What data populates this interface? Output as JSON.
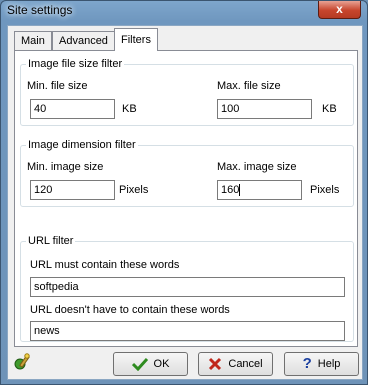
{
  "window": {
    "title": "Site settings",
    "close_glyph": "x"
  },
  "tabs": [
    {
      "label": "Main"
    },
    {
      "label": "Advanced"
    },
    {
      "label": "Filters",
      "active": true
    }
  ],
  "file_size_filter": {
    "legend": "Image file size filter",
    "min_label": "Min. file size",
    "min_value": "40",
    "min_unit": "KB",
    "max_label": "Max. file size",
    "max_value": "100",
    "max_unit": "KB"
  },
  "dimension_filter": {
    "legend": "Image dimension filter",
    "min_label": "Min. image size",
    "min_value": "120",
    "min_unit": "Pixels",
    "max_label": "Max. image size",
    "max_value": "160",
    "max_unit": "Pixels"
  },
  "url_filter": {
    "legend": "URL filter",
    "must_label": "URL must contain these words",
    "must_value": "softpedia",
    "not_label": "URL doesn't have to contain these words",
    "not_value": "news"
  },
  "buttons": {
    "ok": "OK",
    "cancel": "Cancel",
    "help": "Help"
  },
  "icons": {
    "wizard": "wizard-icon",
    "ok": "checkmark-icon",
    "cancel": "x-icon",
    "help": "question-icon"
  },
  "colors": {
    "ok_check": "#2e8b1f",
    "cancel_x": "#c0271b",
    "help_q": "#1a3fa0"
  }
}
